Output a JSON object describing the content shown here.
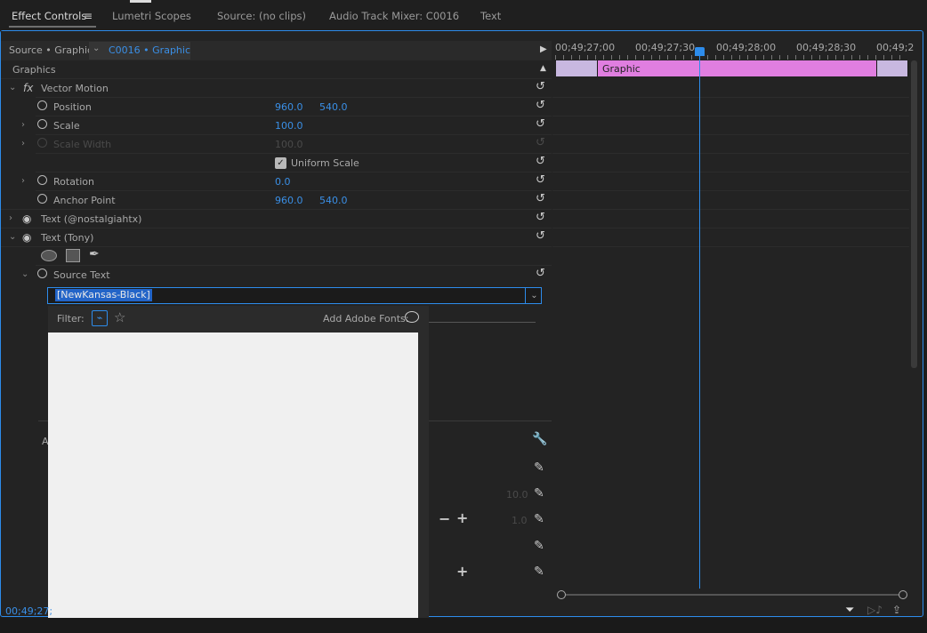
{
  "tabs": {
    "effect_controls": "Effect Controls",
    "lumetri": "Lumetri Scopes",
    "source": "Source: (no clips)",
    "mixer": "Audio Track Mixer: C0016",
    "text": "Text"
  },
  "header": {
    "source": "Source • Graphic",
    "sequence": "C0016 • Graphic",
    "section": "Graphics"
  },
  "effects": {
    "vector_motion": "Vector Motion",
    "position": "Position",
    "position_x": "960.0",
    "position_y": "540.0",
    "scale": "Scale",
    "scale_val": "100.0",
    "scale_width": "Scale Width",
    "scale_width_val": "100.0",
    "uniform_scale": "Uniform Scale",
    "rotation": "Rotation",
    "rotation_val": "0.0",
    "anchor_point": "Anchor Point",
    "anchor_x": "960.0",
    "anchor_y": "540.0",
    "text_nostalgia": "Text (@nostalgiahtx)",
    "text_tony": "Text (Tony)",
    "source_text": "Source Text",
    "font_value": "[NewKansas-Black]"
  },
  "popup": {
    "filter_label": "Filter:",
    "add_fonts_label": "Add Adobe Fonts:"
  },
  "bottom": {
    "partial_a": "A",
    "val_10": "10.0",
    "val_1": "1.0"
  },
  "timeline": {
    "tc1": "00;49;27;00",
    "tc2": "00;49;27;30",
    "tc3": "00;49;28;00",
    "tc4": "00;49;28;30",
    "tc5": "00;49;2",
    "clip_label": "Graphic"
  },
  "footer": {
    "timecode": "00;49;27;"
  },
  "icons": {
    "accent": "#2d8ceb",
    "clip_color": "#e07ee0"
  }
}
